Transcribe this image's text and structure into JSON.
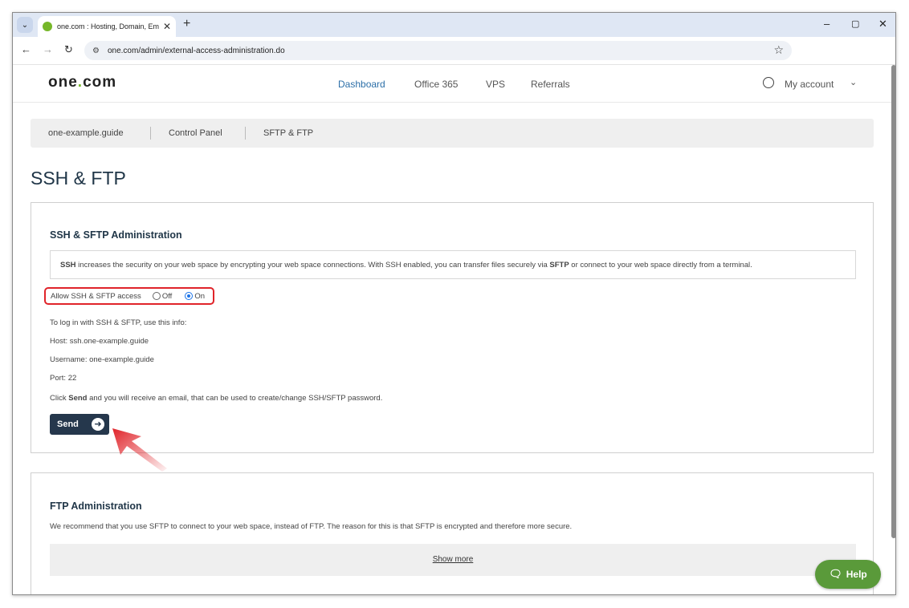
{
  "browser": {
    "tab_title": "one.com : Hosting, Domain, Em",
    "tab_close": "✕",
    "new_tab": "+",
    "url": "one.com/admin/external-access-administration.do",
    "minimize": "–",
    "maximize": "▢",
    "close": "✕"
  },
  "header": {
    "logo_main": "one",
    "logo_dot": ".",
    "logo_end": "com",
    "nav": [
      {
        "label": "Dashboard",
        "active": true
      },
      {
        "label": "Office 365",
        "active": false
      },
      {
        "label": "VPS",
        "active": false
      },
      {
        "label": "Referrals",
        "active": false
      }
    ],
    "account_label": "My account"
  },
  "breadcrumb": [
    "one-example.guide",
    "Control Panel",
    "SFTP & FTP"
  ],
  "page_title": "SSH & FTP",
  "ssh_card": {
    "title": "SSH & SFTP Administration",
    "info_ssh": "SSH",
    "info_text_1": " increases the security on your web space by encrypting your web space connections. With SSH enabled, you can transfer files securely via ",
    "info_sftp": "SFTP",
    "info_text_2": " or connect to your web space directly from a terminal.",
    "access_label": "Allow SSH & SFTP access",
    "option_off": "Off",
    "option_on": "On",
    "selected": "On",
    "login_intro": "To log in with SSH & SFTP, use this info:",
    "host": "Host: ssh.one-example.guide",
    "username": "Username: one-example.guide",
    "port": "Port: 22",
    "send_note_pre": "Click ",
    "send_note_bold": "Send",
    "send_note_post": " and you will receive an email, that can be used to create/change SSH/SFTP password.",
    "send_label": "Send"
  },
  "ftp_card": {
    "title": "FTP Administration",
    "text": "We recommend that you use SFTP to connect to your web space, instead of FTP. The reason for this is that SFTP is encrypted and therefore more secure.",
    "show_more": "Show more"
  },
  "help": {
    "label": "Help"
  },
  "colors": {
    "accent_green": "#76b729",
    "dark_navy": "#25374c",
    "nav_active": "#2c6fa8",
    "highlight_red": "#e0242a",
    "help_green": "#5a9a3a"
  }
}
